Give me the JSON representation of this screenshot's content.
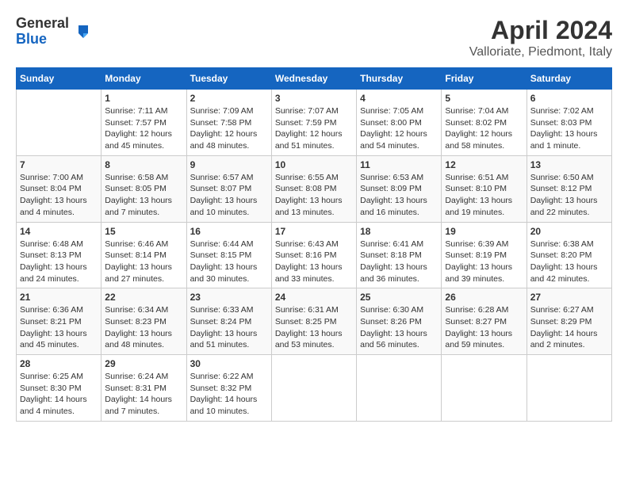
{
  "header": {
    "logo_general": "General",
    "logo_blue": "Blue",
    "month_title": "April 2024",
    "location": "Valloriate, Piedmont, Italy"
  },
  "days_of_week": [
    "Sunday",
    "Monday",
    "Tuesday",
    "Wednesday",
    "Thursday",
    "Friday",
    "Saturday"
  ],
  "weeks": [
    [
      {
        "day": "",
        "info": ""
      },
      {
        "day": "1",
        "info": "Sunrise: 7:11 AM\nSunset: 7:57 PM\nDaylight: 12 hours\nand 45 minutes."
      },
      {
        "day": "2",
        "info": "Sunrise: 7:09 AM\nSunset: 7:58 PM\nDaylight: 12 hours\nand 48 minutes."
      },
      {
        "day": "3",
        "info": "Sunrise: 7:07 AM\nSunset: 7:59 PM\nDaylight: 12 hours\nand 51 minutes."
      },
      {
        "day": "4",
        "info": "Sunrise: 7:05 AM\nSunset: 8:00 PM\nDaylight: 12 hours\nand 54 minutes."
      },
      {
        "day": "5",
        "info": "Sunrise: 7:04 AM\nSunset: 8:02 PM\nDaylight: 12 hours\nand 58 minutes."
      },
      {
        "day": "6",
        "info": "Sunrise: 7:02 AM\nSunset: 8:03 PM\nDaylight: 13 hours\nand 1 minute."
      }
    ],
    [
      {
        "day": "7",
        "info": "Sunrise: 7:00 AM\nSunset: 8:04 PM\nDaylight: 13 hours\nand 4 minutes."
      },
      {
        "day": "8",
        "info": "Sunrise: 6:58 AM\nSunset: 8:05 PM\nDaylight: 13 hours\nand 7 minutes."
      },
      {
        "day": "9",
        "info": "Sunrise: 6:57 AM\nSunset: 8:07 PM\nDaylight: 13 hours\nand 10 minutes."
      },
      {
        "day": "10",
        "info": "Sunrise: 6:55 AM\nSunset: 8:08 PM\nDaylight: 13 hours\nand 13 minutes."
      },
      {
        "day": "11",
        "info": "Sunrise: 6:53 AM\nSunset: 8:09 PM\nDaylight: 13 hours\nand 16 minutes."
      },
      {
        "day": "12",
        "info": "Sunrise: 6:51 AM\nSunset: 8:10 PM\nDaylight: 13 hours\nand 19 minutes."
      },
      {
        "day": "13",
        "info": "Sunrise: 6:50 AM\nSunset: 8:12 PM\nDaylight: 13 hours\nand 22 minutes."
      }
    ],
    [
      {
        "day": "14",
        "info": "Sunrise: 6:48 AM\nSunset: 8:13 PM\nDaylight: 13 hours\nand 24 minutes."
      },
      {
        "day": "15",
        "info": "Sunrise: 6:46 AM\nSunset: 8:14 PM\nDaylight: 13 hours\nand 27 minutes."
      },
      {
        "day": "16",
        "info": "Sunrise: 6:44 AM\nSunset: 8:15 PM\nDaylight: 13 hours\nand 30 minutes."
      },
      {
        "day": "17",
        "info": "Sunrise: 6:43 AM\nSunset: 8:16 PM\nDaylight: 13 hours\nand 33 minutes."
      },
      {
        "day": "18",
        "info": "Sunrise: 6:41 AM\nSunset: 8:18 PM\nDaylight: 13 hours\nand 36 minutes."
      },
      {
        "day": "19",
        "info": "Sunrise: 6:39 AM\nSunset: 8:19 PM\nDaylight: 13 hours\nand 39 minutes."
      },
      {
        "day": "20",
        "info": "Sunrise: 6:38 AM\nSunset: 8:20 PM\nDaylight: 13 hours\nand 42 minutes."
      }
    ],
    [
      {
        "day": "21",
        "info": "Sunrise: 6:36 AM\nSunset: 8:21 PM\nDaylight: 13 hours\nand 45 minutes."
      },
      {
        "day": "22",
        "info": "Sunrise: 6:34 AM\nSunset: 8:23 PM\nDaylight: 13 hours\nand 48 minutes."
      },
      {
        "day": "23",
        "info": "Sunrise: 6:33 AM\nSunset: 8:24 PM\nDaylight: 13 hours\nand 51 minutes."
      },
      {
        "day": "24",
        "info": "Sunrise: 6:31 AM\nSunset: 8:25 PM\nDaylight: 13 hours\nand 53 minutes."
      },
      {
        "day": "25",
        "info": "Sunrise: 6:30 AM\nSunset: 8:26 PM\nDaylight: 13 hours\nand 56 minutes."
      },
      {
        "day": "26",
        "info": "Sunrise: 6:28 AM\nSunset: 8:27 PM\nDaylight: 13 hours\nand 59 minutes."
      },
      {
        "day": "27",
        "info": "Sunrise: 6:27 AM\nSunset: 8:29 PM\nDaylight: 14 hours\nand 2 minutes."
      }
    ],
    [
      {
        "day": "28",
        "info": "Sunrise: 6:25 AM\nSunset: 8:30 PM\nDaylight: 14 hours\nand 4 minutes."
      },
      {
        "day": "29",
        "info": "Sunrise: 6:24 AM\nSunset: 8:31 PM\nDaylight: 14 hours\nand 7 minutes."
      },
      {
        "day": "30",
        "info": "Sunrise: 6:22 AM\nSunset: 8:32 PM\nDaylight: 14 hours\nand 10 minutes."
      },
      {
        "day": "",
        "info": ""
      },
      {
        "day": "",
        "info": ""
      },
      {
        "day": "",
        "info": ""
      },
      {
        "day": "",
        "info": ""
      }
    ]
  ]
}
